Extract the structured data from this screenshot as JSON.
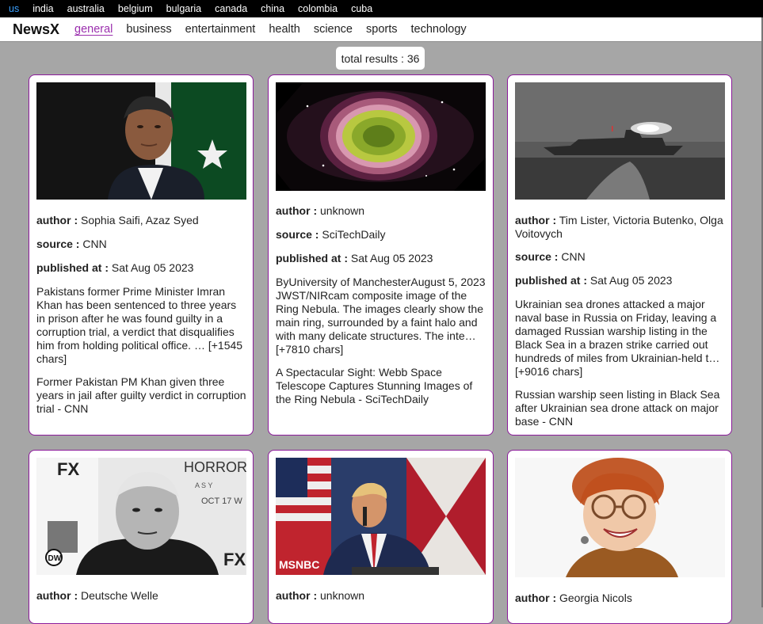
{
  "countries": [
    "us",
    "india",
    "australia",
    "belgium",
    "bulgaria",
    "canada",
    "china",
    "colombia",
    "cuba"
  ],
  "brand": "NewsX",
  "categories": [
    "general",
    "business",
    "entertainment",
    "health",
    "science",
    "sports",
    "technology"
  ],
  "total_results": "total results : 36",
  "labels": {
    "author": "author :",
    "source": "source :",
    "published": "published at :"
  },
  "cards": [
    {
      "author": "Sophia Saifi, Azaz Syed",
      "source": "CNN",
      "published": "Sat Aug 05 2023",
      "description": "Pakistans former Prime Minister Imran Khan has been sentenced to three years in prison after he was found guilty in a corruption trial, a verdict that disqualifies him from holding political office. … [+1545 chars]",
      "title": "Former Pakistan PM Khan given three years in jail after guilty verdict in corruption trial - CNN"
    },
    {
      "author": "unknown",
      "source": "SciTechDaily",
      "published": "Sat Aug 05 2023",
      "description": "ByUniversity of ManchesterAugust 5, 2023 JWST/NIRcam composite image of the Ring Nebula. The images clearly show the main ring, surrounded by a faint halo and with many delicate structures. The inte… [+7810 chars]",
      "title": "A Spectacular Sight: Webb Space Telescope Captures Stunning Images of the Ring Nebula - SciTechDaily"
    },
    {
      "author": "Tim Lister, Victoria Butenko, Olga Voitovych",
      "source": "CNN",
      "published": "Sat Aug 05 2023",
      "description": "Ukrainian sea drones attacked a major naval base in Russia on Friday, leaving a damaged Russian warship listing in the Black Sea in a brazen strike carried out hundreds of miles from Ukrainian-held t… [+9016 chars]",
      "title": "Russian warship seen listing in Black Sea after Ukrainian sea drone attack on major base - CNN"
    },
    {
      "author": "Deutsche Welle"
    },
    {
      "author": "unknown"
    },
    {
      "author": "Georgia Nicols"
    }
  ],
  "image_text": {
    "fx": "FX",
    "horror": "HORROR",
    "asy": "A S Y",
    "oct": "OCT 17 W",
    "dw": "DW",
    "msnbc": "MSNBC"
  }
}
